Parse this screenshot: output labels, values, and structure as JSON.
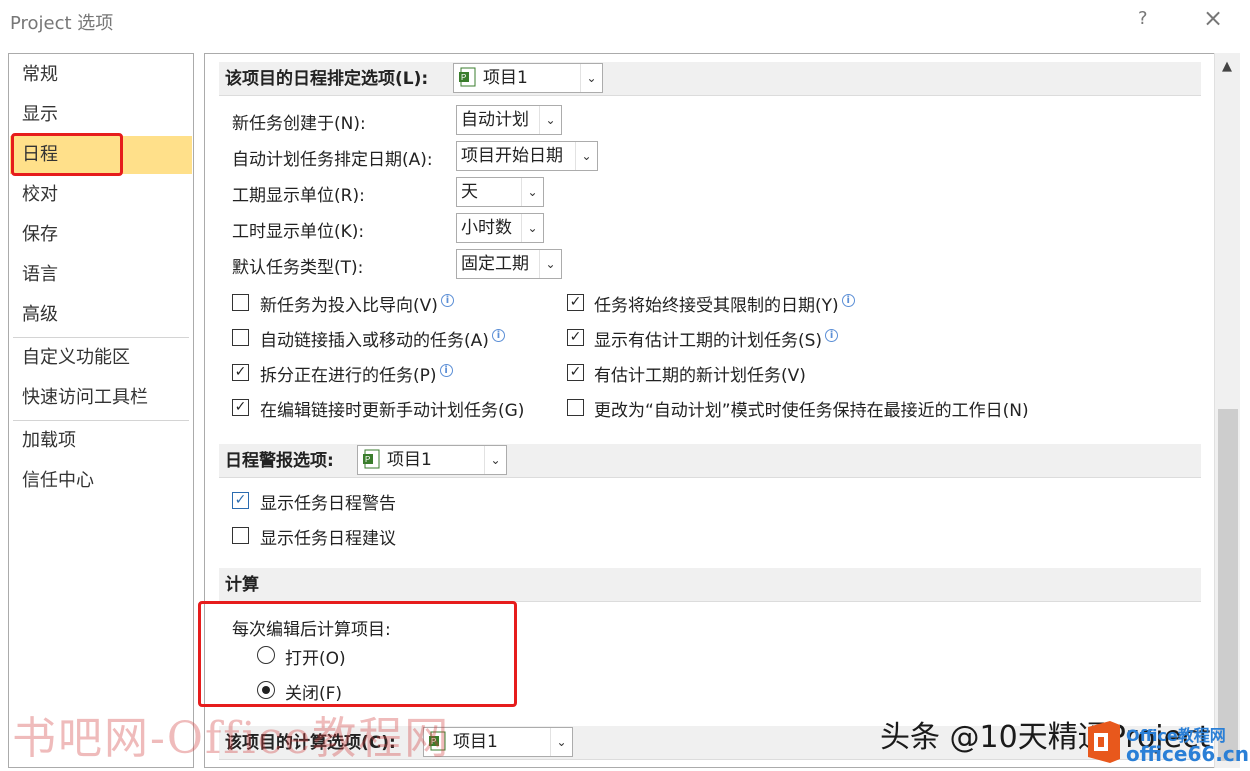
{
  "window": {
    "title": "Project 选项",
    "help_icon": "?",
    "close_icon": "×"
  },
  "sidebar": {
    "items": [
      {
        "label": "常规"
      },
      {
        "label": "显示"
      },
      {
        "label": "日程",
        "selected": true
      },
      {
        "label": "校对"
      },
      {
        "label": "保存"
      },
      {
        "label": "语言"
      },
      {
        "label": "高级"
      },
      {
        "label": "自定义功能区"
      },
      {
        "label": "快速访问工具栏"
      },
      {
        "label": "加载项"
      },
      {
        "label": "信任中心"
      }
    ]
  },
  "schedule_section": {
    "title": "该项目的日程排定选项(L):",
    "project_value": "项目1",
    "fields": [
      {
        "label": "新任务创建于(N):",
        "value": "自动计划"
      },
      {
        "label": "自动计划任务排定日期(A):",
        "value": "项目开始日期"
      },
      {
        "label": "工期显示单位(R):",
        "value": "天"
      },
      {
        "label": "工时显示单位(K):",
        "value": "小时数"
      },
      {
        "label": "默认任务类型(T):",
        "value": "固定工期"
      }
    ],
    "checkboxes_left": [
      {
        "label": "新任务为投入比导向(V)",
        "checked": false,
        "info": true
      },
      {
        "label": "自动链接插入或移动的任务(A)",
        "checked": false,
        "info": true
      },
      {
        "label": "拆分正在进行的任务(P)",
        "checked": true,
        "info": true
      },
      {
        "label": "在编辑链接时更新手动计划任务(G)",
        "checked": true,
        "info": false
      }
    ],
    "checkboxes_right": [
      {
        "label": "任务将始终接受其限制的日期(Y)",
        "checked": true,
        "info": true
      },
      {
        "label": "显示有估计工期的计划任务(S)",
        "checked": true,
        "info": true
      },
      {
        "label": "有估计工期的新计划任务(V)",
        "checked": true,
        "info": false
      },
      {
        "label": "更改为“自动计划”模式时使任务保持在最接近的工作日(N)",
        "checked": false,
        "info": false
      }
    ]
  },
  "alerts_section": {
    "title": "日程警报选项:",
    "project_value": "项目1",
    "checkboxes": [
      {
        "label": "显示任务日程警告",
        "checked": true
      },
      {
        "label": "显示任务日程建议",
        "checked": false
      }
    ]
  },
  "calc_section": {
    "title": "计算",
    "prompt": "每次编辑后计算项目:",
    "options": [
      {
        "label": "打开(O)",
        "selected": false
      },
      {
        "label": "关闭(F)",
        "selected": true
      }
    ]
  },
  "calc_options_section": {
    "title": "该项目的计算选项(C):",
    "project_value": "项目1"
  },
  "watermarks": {
    "left": "书吧网-Office教程网",
    "right": "头条 @10天精通Project",
    "logo_line1": "Office教程网",
    "logo_line2": "office66.cn"
  },
  "colors": {
    "selected_nav": "#ffe08a",
    "highlight_box": "#e61c1c",
    "section_bg": "#f0f0f0"
  }
}
